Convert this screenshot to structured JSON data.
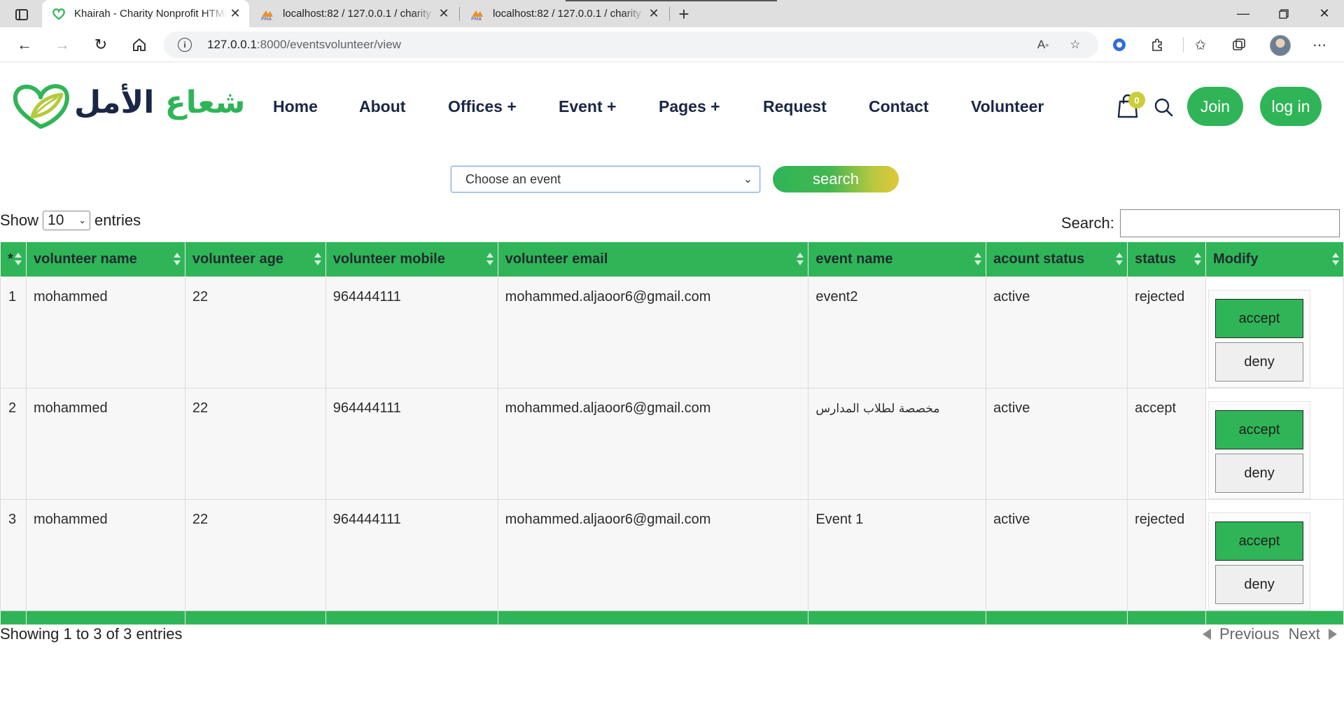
{
  "browser": {
    "tabs": [
      {
        "title": "Khairah - Charity Nonprofit HTML",
        "icon": "heart-logo-icon",
        "active": true
      },
      {
        "title": "localhost:82 / 127.0.0.1 / charity",
        "icon": "phpmyadmin-icon",
        "active": false
      },
      {
        "title": "localhost:82 / 127.0.0.1 / charity",
        "icon": "phpmyadmin-icon",
        "active": false
      }
    ],
    "url_host": "127.0.0.1",
    "url_rest": ":8000/eventsvolunteer/view"
  },
  "site": {
    "logo_text_dark": "الأمل",
    "logo_text_green": "شعاع",
    "nav": [
      "Home",
      "About",
      "Offices +",
      "Event +",
      "Pages +",
      "Request",
      "Contact",
      "Volunteer"
    ],
    "cart_count": "0",
    "join_label": "Join",
    "login_label": "log in",
    "brand_green": "#2fb557",
    "brand_yellow": "#ecc93a",
    "brand_navy": "#1b2746"
  },
  "filter": {
    "select_value": "Choose an event",
    "search_label": "search"
  },
  "table": {
    "length_prefix": "Show",
    "length_value": "10",
    "length_suffix": "entries",
    "search_label": "Search:",
    "columns": [
      "*",
      "volunteer name",
      "volunteer age",
      "volunteer mobile",
      "volunteer email",
      "event name",
      "acount status",
      "status",
      "Modify"
    ],
    "rows": [
      {
        "num": "1",
        "name": "mohammed",
        "age": "22",
        "mobile": "964444111",
        "email": "mohammed.aljaoor6@gmail.com",
        "event": "event2",
        "account_status": "active",
        "status": "rejected"
      },
      {
        "num": "2",
        "name": "mohammed",
        "age": "22",
        "mobile": "964444111",
        "email": "mohammed.aljaoor6@gmail.com",
        "event": "مخصصة لطلاب المدارس",
        "account_status": "active",
        "status": "accept"
      },
      {
        "num": "3",
        "name": "mohammed",
        "age": "22",
        "mobile": "964444111",
        "email": "mohammed.aljaoor6@gmail.com",
        "event": "Event 1",
        "account_status": "active",
        "status": "rejected"
      }
    ],
    "accept_label": "accept",
    "deny_label": "deny",
    "info": "Showing 1 to 3 of 3 entries",
    "previous_label": "Previous",
    "next_label": "Next"
  }
}
